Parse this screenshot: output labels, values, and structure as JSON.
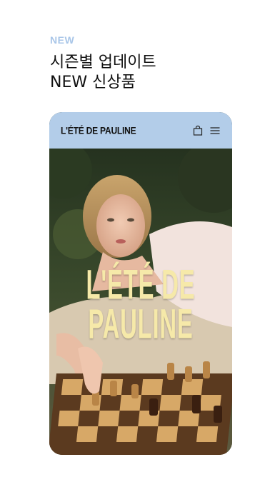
{
  "promo": {
    "tag": "NEW",
    "headline_line1": "시즌별 업데이트",
    "headline_line2": "NEW 신상품"
  },
  "app": {
    "brand": "L'ÉTÉ DE PAULINE",
    "header_bg": "#b3cde9",
    "icons": [
      "shopping-bag-icon",
      "menu-icon"
    ]
  },
  "hero": {
    "title_line1": "L'ÉTÉ DE",
    "title_line2": "PAULINE",
    "title_color": "#f6e9a9"
  }
}
